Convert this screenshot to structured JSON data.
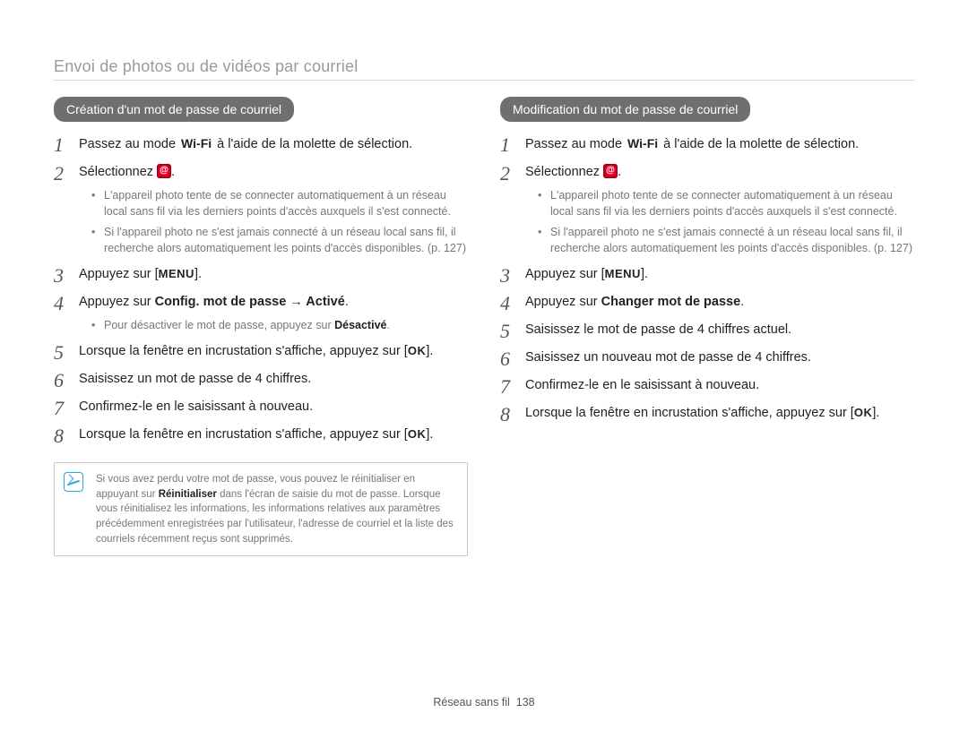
{
  "header": {
    "title": "Envoi de photos ou de vidéos par courriel"
  },
  "left": {
    "heading": "Création d'un mot de passe de courriel",
    "s1_a": "Passez au mode ",
    "wifi": "Wi-Fi",
    "s1_b": " à l'aide de la molette de sélection.",
    "s2_a": "Sélectionnez ",
    "s2_b": ".",
    "s2_sub1": "L'appareil photo tente de se connecter automatiquement à un réseau local sans fil via les derniers points d'accès auxquels il s'est connecté.",
    "s2_sub2": "Si l'appareil photo ne s'est jamais connecté à un réseau local sans fil, il recherche alors automatiquement les points d'accès disponibles. (p. 127)",
    "s3_a": "Appuyez sur [",
    "menu": "MENU",
    "s3_b": "].",
    "s4_a": "Appuyez sur ",
    "s4_bold": "Config. mot de passe → Activé",
    "s4_b": ".",
    "s4_sub1_a": "Pour désactiver le mot de passe, appuyez sur ",
    "s4_sub1_bold": "Désactivé",
    "s4_sub1_b": ".",
    "s5_a": "Lorsque la fenêtre en incrustation s'affiche, appuyez sur [",
    "ok": "OK",
    "s5_b": "].",
    "s6": "Saisissez un mot de passe de 4 chiffres.",
    "s7": "Confirmez-le en le saisissant à nouveau.",
    "s8_a": "Lorsque la fenêtre en incrustation s'affiche, appuyez sur [",
    "s8_b": "].",
    "note_a": "Si vous avez perdu votre mot de passe, vous pouvez le réinitialiser en appuyant sur ",
    "note_bold": "Réinitialiser",
    "note_b": " dans l'écran de saisie du mot de passe. Lorsque vous réinitialisez les informations, les informations relatives aux paramètres précédemment enregistrées par l'utilisateur, l'adresse de courriel et la liste des courriels récemment reçus sont supprimés."
  },
  "right": {
    "heading": "Modification du mot de passe de courriel",
    "s1_a": "Passez au mode ",
    "wifi": "Wi-Fi",
    "s1_b": " à l'aide de la molette de sélection.",
    "s2_a": "Sélectionnez ",
    "s2_b": ".",
    "s2_sub1": "L'appareil photo tente de se connecter automatiquement à un réseau local sans fil via les derniers points d'accès auxquels il s'est connecté.",
    "s2_sub2": "Si l'appareil photo ne s'est jamais connecté à un réseau local sans fil, il recherche alors automatiquement les points d'accès disponibles. (p. 127)",
    "s3_a": "Appuyez sur [",
    "menu": "MENU",
    "s3_b": "].",
    "s4_a": "Appuyez sur ",
    "s4_bold": "Changer mot de passe",
    "s4_b": ".",
    "s5": "Saisissez le mot de passe de 4 chiffres actuel.",
    "s6": "Saisissez un nouveau mot de passe de 4 chiffres.",
    "s7": "Confirmez-le en le saisissant à nouveau.",
    "s8_a": "Lorsque la fenêtre en incrustation s'affiche, appuyez sur [",
    "ok": "OK",
    "s8_b": "]."
  },
  "footer": {
    "section": "Réseau sans fil",
    "page": "138"
  }
}
